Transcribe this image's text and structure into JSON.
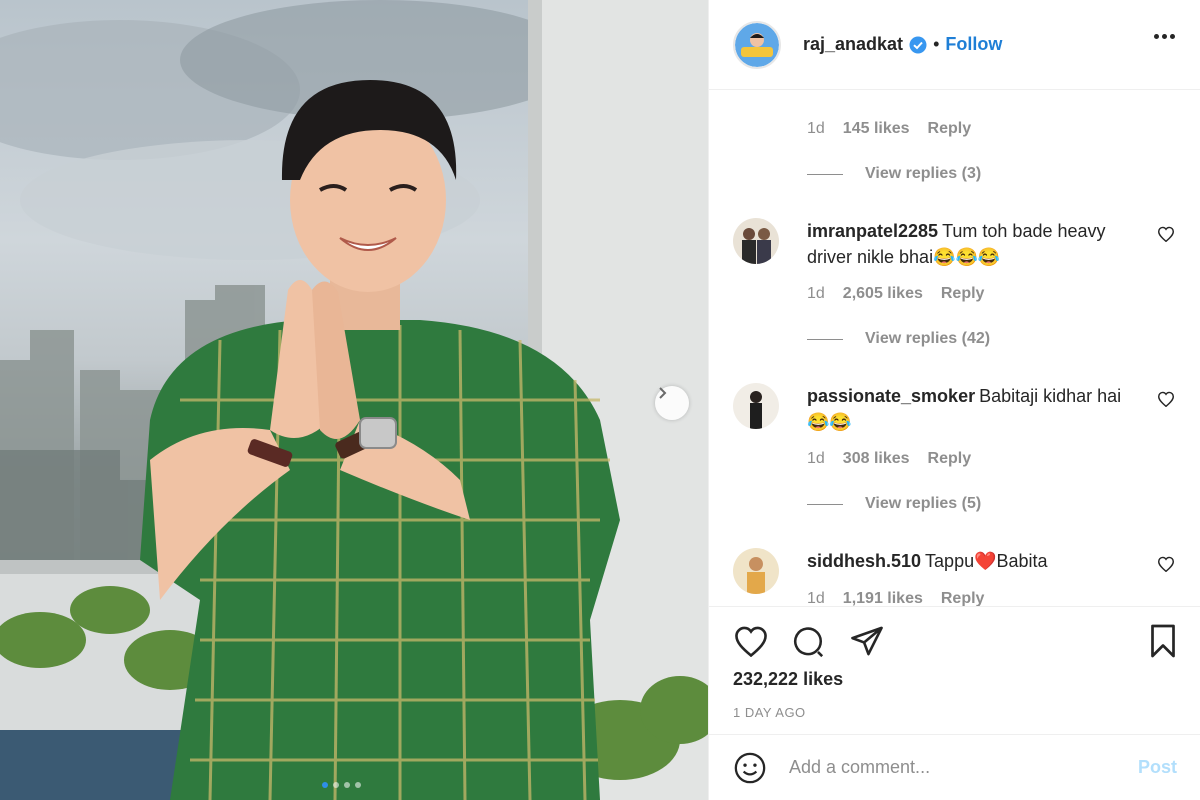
{
  "post": {
    "username": "raj_anadkat",
    "follow_label": "Follow",
    "separator": "•",
    "likes_label": "232,222 likes",
    "timestamp": "1 DAY AGO",
    "comment_placeholder": "Add a comment...",
    "post_label": "Post"
  },
  "partial_comment": {
    "visible_text": "",
    "age": "1d",
    "likes": "145 likes",
    "reply": "Reply",
    "view_replies": "View replies (3)"
  },
  "comments": [
    {
      "username": "imranpatel2285",
      "text": "Tum toh bade heavy driver nikle bhai😂😂😂",
      "age": "1d",
      "likes": "2,605 likes",
      "reply": "Reply",
      "view_replies": "View replies (42)"
    },
    {
      "username": "passionate_smoker",
      "text": "Babitaji kidhar hai😂😂",
      "age": "1d",
      "likes": "308 likes",
      "reply": "Reply",
      "view_replies": "View replies (5)"
    },
    {
      "username": "siddhesh.510",
      "text": "Tappu❤️Babita",
      "age": "1d",
      "likes": "1,191 likes",
      "reply": "Reply"
    }
  ],
  "colors": {
    "link": "#1f7fd6",
    "muted": "#8e8e8e",
    "kurta_green": "#2f7a3e",
    "carousel_active": "#2f8ee8"
  },
  "icons": {
    "header": [
      "verified-badge-icon",
      "more-options-icon"
    ],
    "actions": [
      "heart-icon",
      "comment-icon",
      "share-icon",
      "bookmark-icon",
      "emoji-icon"
    ]
  },
  "carousel": {
    "slide_count": 4,
    "active_index": 0
  }
}
